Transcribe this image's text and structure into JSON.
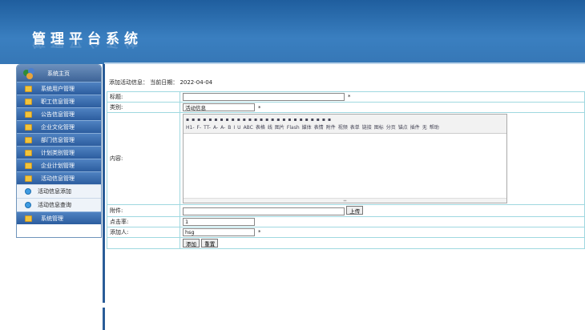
{
  "header": {
    "title": "管理平台系统"
  },
  "sidebar": {
    "home": "系统主页",
    "items": [
      {
        "label": "系统用户管理"
      },
      {
        "label": "职工信息管理"
      },
      {
        "label": "公告信息管理"
      },
      {
        "label": "企业文化管理"
      },
      {
        "label": "部门信息管理"
      },
      {
        "label": "计划类别管理"
      },
      {
        "label": "企业计划管理"
      },
      {
        "label": "活动信息管理"
      }
    ],
    "subitems": [
      {
        "label": "活动信息添加"
      },
      {
        "label": "活动信息查询"
      }
    ],
    "last": {
      "label": "系统管理"
    }
  },
  "main": {
    "info": "添加活动信息：  当前日期：  2022-04-04",
    "form": {
      "title_label": "标题:",
      "title_value": "",
      "title_req": "*",
      "type_label": "类别:",
      "type_value": "活动信息",
      "type_req": "*",
      "content_label": "内容:",
      "attach_label": "附件:",
      "attach_value": "",
      "upload": "上传",
      "clicks_label": "点击率:",
      "clicks_value": "1",
      "adder_label": "添加人:",
      "adder_value": "hsg",
      "adder_req": "*",
      "add_btn": "添加",
      "reset_btn": "重置"
    },
    "editor_toolbar": {
      "row1": [
        "源码",
        "撤销",
        "重做",
        "预览",
        "打印",
        "模板",
        "代码",
        "剪切",
        "复制",
        "粘贴",
        "纯文本",
        "Word",
        "左对齐",
        "居中",
        "右对齐",
        "两端",
        "编号",
        "项目",
        "缩进",
        "减进",
        "下标",
        "上标",
        "清格式",
        "全选",
        "插入",
        "全屏"
      ],
      "row2": [
        "H1-",
        "F-",
        "TT-",
        "A-",
        "A-",
        "B",
        "I",
        "U",
        "ABC",
        "表格",
        "线",
        "图片",
        "Flash",
        "媒体",
        "表情",
        "附件",
        "视频",
        "表单",
        "链接",
        "图标",
        "分页",
        "锚点",
        "插件",
        "无",
        "帮助"
      ]
    }
  },
  "colors": {
    "header": "#2d6fb0",
    "menu": "#3a6fb0",
    "sub": "#eef3f9",
    "border": "#9fd8e0"
  }
}
